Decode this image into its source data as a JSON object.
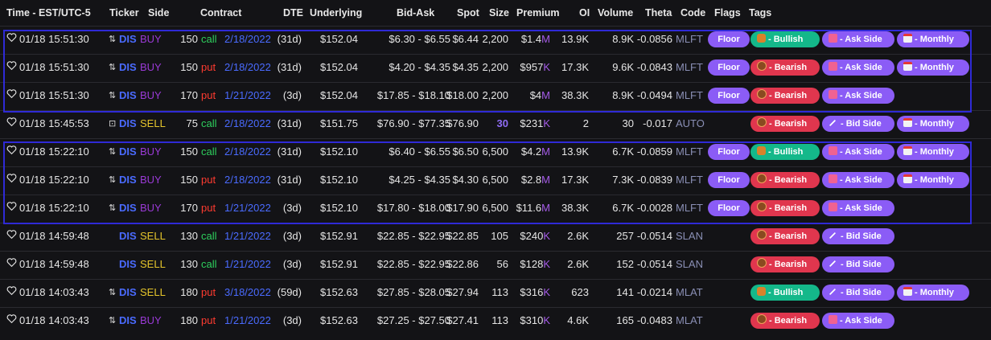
{
  "headers": {
    "time": "Time - EST/UTC-5",
    "ticker": "Ticker",
    "side": "Side",
    "contract": "Contract",
    "dte": "DTE",
    "underlying": "Underlying",
    "bidask": "Bid-Ask",
    "spot": "Spot",
    "size": "Size",
    "premium": "Premium",
    "oi": "OI",
    "volume": "Volume",
    "theta": "Theta",
    "code": "Code",
    "flags": "Flags",
    "tags": "Tags"
  },
  "rows": [
    {
      "time": "01/18 15:51:30",
      "swap": "⇅",
      "ticker": "DIS",
      "side": "BUY",
      "strike": "150",
      "type": "call",
      "exp": "2/18/2022",
      "dte": "(31d)",
      "underlying": "$152.04",
      "bidask": "$6.30 - $6.55",
      "spot": "$6.44",
      "size": "2,200",
      "premium": "$1.4",
      "unit": "M",
      "oi": "13.9K",
      "volume": "8.9K",
      "theta": "-0.0856",
      "code": "MLFT",
      "flag": "Floor",
      "sentiment": "- Bullish",
      "sidetag": "- Ask Side",
      "monthly": "- Monthly"
    },
    {
      "time": "01/18 15:51:30",
      "swap": "⇅",
      "ticker": "DIS",
      "side": "BUY",
      "strike": "150",
      "type": "put",
      "exp": "2/18/2022",
      "dte": "(31d)",
      "underlying": "$152.04",
      "bidask": "$4.20 - $4.35",
      "spot": "$4.35",
      "size": "2,200",
      "premium": "$957",
      "unit": "K",
      "oi": "17.3K",
      "volume": "9.6K",
      "theta": "-0.0843",
      "code": "MLFT",
      "flag": "Floor",
      "sentiment": "- Bearish",
      "sidetag": "- Ask Side",
      "monthly": "- Monthly"
    },
    {
      "time": "01/18 15:51:30",
      "swap": "⇅",
      "ticker": "DIS",
      "side": "BUY",
      "strike": "170",
      "type": "put",
      "exp": "1/21/2022",
      "dte": "(3d)",
      "underlying": "$152.04",
      "bidask": "$17.85 - $18.10",
      "spot": "$18.00",
      "size": "2,200",
      "premium": "$4",
      "unit": "M",
      "oi": "38.3K",
      "volume": "8.9K",
      "theta": "-0.0494",
      "code": "MLFT",
      "flag": "Floor",
      "sentiment": "- Bearish",
      "sidetag": "- Ask Side",
      "monthly": ""
    },
    {
      "time": "01/18 15:45:53",
      "swap": "⊡",
      "ticker": "DIS",
      "side": "SELL",
      "strike": "75",
      "type": "call",
      "exp": "2/18/2022",
      "dte": "(31d)",
      "underlying": "$151.75",
      "bidask": "$76.90 - $77.35",
      "spot": "$76.90",
      "size": "30",
      "premium": "$231",
      "unit": "K",
      "oi": "2",
      "volume": "30",
      "theta": "-0.017",
      "code": "AUTO",
      "flag": "",
      "sentiment": "- Bearish",
      "sidetag": "- Bid Side",
      "monthly": "- Monthly"
    },
    {
      "time": "01/18 15:22:10",
      "swap": "⇅",
      "ticker": "DIS",
      "side": "BUY",
      "strike": "150",
      "type": "call",
      "exp": "2/18/2022",
      "dte": "(31d)",
      "underlying": "$152.10",
      "bidask": "$6.40 - $6.55",
      "spot": "$6.50",
      "size": "6,500",
      "premium": "$4.2",
      "unit": "M",
      "oi": "13.9K",
      "volume": "6.7K",
      "theta": "-0.0859",
      "code": "MLFT",
      "flag": "Floor",
      "sentiment": "- Bullish",
      "sidetag": "- Ask Side",
      "monthly": "- Monthly"
    },
    {
      "time": "01/18 15:22:10",
      "swap": "⇅",
      "ticker": "DIS",
      "side": "BUY",
      "strike": "150",
      "type": "put",
      "exp": "2/18/2022",
      "dte": "(31d)",
      "underlying": "$152.10",
      "bidask": "$4.25 - $4.35",
      "spot": "$4.30",
      "size": "6,500",
      "premium": "$2.8",
      "unit": "M",
      "oi": "17.3K",
      "volume": "7.3K",
      "theta": "-0.0839",
      "code": "MLFT",
      "flag": "Floor",
      "sentiment": "- Bearish",
      "sidetag": "- Ask Side",
      "monthly": "- Monthly"
    },
    {
      "time": "01/18 15:22:10",
      "swap": "⇅",
      "ticker": "DIS",
      "side": "BUY",
      "strike": "170",
      "type": "put",
      "exp": "1/21/2022",
      "dte": "(3d)",
      "underlying": "$152.10",
      "bidask": "$17.80 - $18.00",
      "spot": "$17.90",
      "size": "6,500",
      "premium": "$11.6",
      "unit": "M",
      "oi": "38.3K",
      "volume": "6.7K",
      "theta": "-0.0028",
      "code": "MLFT",
      "flag": "Floor",
      "sentiment": "- Bearish",
      "sidetag": "- Ask Side",
      "monthly": ""
    },
    {
      "time": "01/18 14:59:48",
      "swap": "",
      "ticker": "DIS",
      "side": "SELL",
      "strike": "130",
      "type": "call",
      "exp": "1/21/2022",
      "dte": "(3d)",
      "underlying": "$152.91",
      "bidask": "$22.85 - $22.95",
      "spot": "$22.85",
      "size": "105",
      "premium": "$240",
      "unit": "K",
      "oi": "2.6K",
      "volume": "257",
      "theta": "-0.0514",
      "code": "SLAN",
      "flag": "",
      "sentiment": "- Bearish",
      "sidetag": "- Bid Side",
      "monthly": ""
    },
    {
      "time": "01/18 14:59:48",
      "swap": "",
      "ticker": "DIS",
      "side": "SELL",
      "strike": "130",
      "type": "call",
      "exp": "1/21/2022",
      "dte": "(3d)",
      "underlying": "$152.91",
      "bidask": "$22.85 - $22.95",
      "spot": "$22.86",
      "size": "56",
      "premium": "$128",
      "unit": "K",
      "oi": "2.6K",
      "volume": "152",
      "theta": "-0.0514",
      "code": "SLAN",
      "flag": "",
      "sentiment": "- Bearish",
      "sidetag": "- Bid Side",
      "monthly": ""
    },
    {
      "time": "01/18 14:03:43",
      "swap": "⇅",
      "ticker": "DIS",
      "side": "SELL",
      "strike": "180",
      "type": "put",
      "exp": "3/18/2022",
      "dte": "(59d)",
      "underlying": "$152.63",
      "bidask": "$27.85 - $28.05",
      "spot": "$27.94",
      "size": "113",
      "premium": "$316",
      "unit": "K",
      "oi": "623",
      "volume": "141",
      "theta": "-0.0214",
      "code": "MLAT",
      "flag": "",
      "sentiment": "- Bullish",
      "sidetag": "- Bid Side",
      "monthly": "- Monthly"
    },
    {
      "time": "01/18 14:03:43",
      "swap": "⇅",
      "ticker": "DIS",
      "side": "BUY",
      "strike": "180",
      "type": "put",
      "exp": "1/21/2022",
      "dte": "(3d)",
      "underlying": "$152.63",
      "bidask": "$27.25 - $27.50",
      "spot": "$27.41",
      "size": "113",
      "premium": "$310",
      "unit": "K",
      "oi": "4.6K",
      "volume": "165",
      "theta": "-0.0483",
      "code": "MLAT",
      "flag": "",
      "sentiment": "- Bearish",
      "sidetag": "- Ask Side",
      "monthly": ""
    }
  ]
}
